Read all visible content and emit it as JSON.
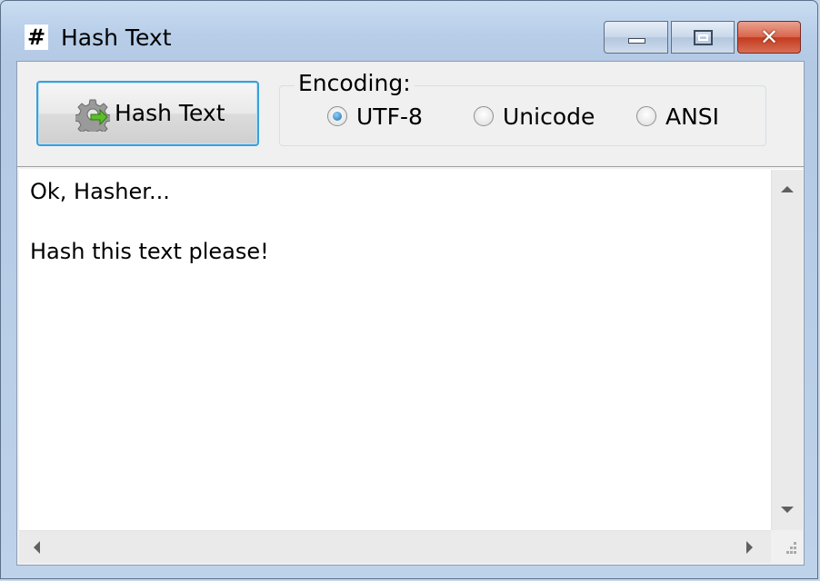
{
  "window": {
    "icon_glyph": "#",
    "title": "Hash Text",
    "buttons": {
      "minimize": "minimize-icon",
      "maximize": "maximize-icon",
      "close": "close-icon"
    }
  },
  "toolbar": {
    "hash_button_label": "Hash Text",
    "hash_button_icon": "gear-arrow-icon"
  },
  "encoding": {
    "legend": "Encoding:",
    "options": [
      {
        "label": "UTF-8",
        "checked": true
      },
      {
        "label": "Unicode",
        "checked": false
      },
      {
        "label": "ANSI",
        "checked": false
      }
    ]
  },
  "editor": {
    "lines": [
      "Ok, Hasher...",
      "",
      "Hash this text please!"
    ]
  },
  "colors": {
    "focus_border": "#3aa0d9",
    "close_button": "#c53a1e",
    "title_bar": "#b7cde8"
  }
}
